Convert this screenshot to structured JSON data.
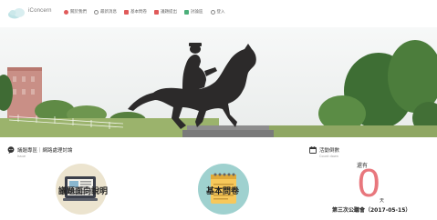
{
  "header": {
    "logo_text": "iConcern",
    "nav": [
      {
        "label": "關於我們",
        "icon": "info-icon",
        "color": "#e05a5a"
      },
      {
        "label": "最新消息",
        "icon": "news-icon",
        "color": "#888888"
      },
      {
        "label": "基本問卷",
        "icon": "survey-icon",
        "color": "#e05a5a"
      },
      {
        "label": "議題提出",
        "icon": "issue-icon",
        "color": "#e05a5a"
      },
      {
        "label": "討論區",
        "icon": "chat-icon",
        "color": "#4caf7a"
      },
      {
        "label": "登入",
        "icon": "user-icon",
        "color": "#888888"
      }
    ]
  },
  "hero": {
    "image": "equestrian-statue-photo"
  },
  "issues": {
    "title": "議題專區｜網路處理討論",
    "subtitle": "Issue",
    "items": [
      {
        "label": "議題面向說明",
        "icon": "newspaper-icon",
        "bg": "#ece4cf"
      },
      {
        "label": "基本問卷",
        "icon": "notepad-icon",
        "bg": "#9fd1cf"
      }
    ]
  },
  "countdown": {
    "title": "活動倒數",
    "subtitle": "Count down",
    "still_label": "還有",
    "value": "0",
    "unit": "天",
    "event": "第三次公聽會（2017-05-15）",
    "accent": "#e8777d"
  }
}
